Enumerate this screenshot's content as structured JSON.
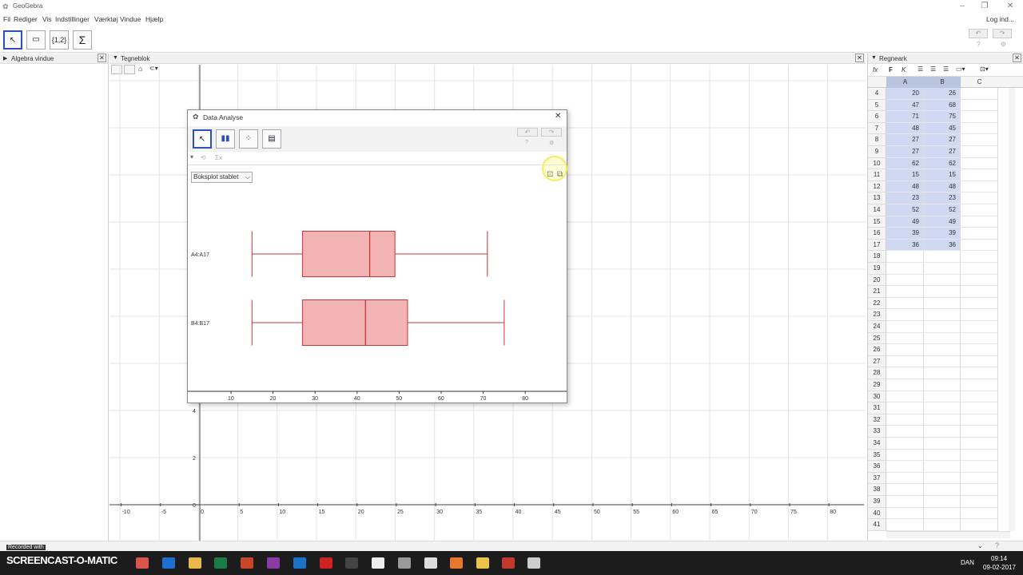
{
  "window": {
    "title": "GeoGebra",
    "login": "Log ind..."
  },
  "menu": [
    "Fil",
    "Rediger",
    "Vis",
    "Indstillinger",
    "Værktøj",
    "Vindue",
    "Hjælp"
  ],
  "toolbar": {
    "tools": [
      "↖",
      "▭",
      "{1,2}",
      "Σ"
    ]
  },
  "panels": {
    "algebra": "Algebra vindue",
    "graphics": "Tegneblok",
    "spreadsheet": "Regneark"
  },
  "graphics_axes": {
    "x_ticks": [
      "-10",
      "-5",
      "0",
      "5",
      "10",
      "15",
      "20",
      "25",
      "30",
      "35",
      "40",
      "45",
      "50",
      "55",
      "60",
      "65",
      "70",
      "75",
      "80"
    ],
    "y_ticks": [
      "0",
      "2",
      "4"
    ]
  },
  "sheet": {
    "columns": [
      "A",
      "B",
      "C"
    ],
    "rows": [
      {
        "n": "4",
        "a": "20",
        "b": "26"
      },
      {
        "n": "5",
        "a": "47",
        "b": "68"
      },
      {
        "n": "6",
        "a": "71",
        "b": "75"
      },
      {
        "n": "7",
        "a": "48",
        "b": "45"
      },
      {
        "n": "8",
        "a": "27",
        "b": "27"
      },
      {
        "n": "9",
        "a": "27",
        "b": "27"
      },
      {
        "n": "10",
        "a": "62",
        "b": "62"
      },
      {
        "n": "11",
        "a": "15",
        "b": "15"
      },
      {
        "n": "12",
        "a": "48",
        "b": "48"
      },
      {
        "n": "13",
        "a": "23",
        "b": "23"
      },
      {
        "n": "14",
        "a": "52",
        "b": "52"
      },
      {
        "n": "15",
        "a": "49",
        "b": "49"
      },
      {
        "n": "16",
        "a": "39",
        "b": "39"
      },
      {
        "n": "17",
        "a": "36",
        "b": "36"
      },
      {
        "n": "18",
        "a": "",
        "b": ""
      },
      {
        "n": "19",
        "a": "",
        "b": ""
      },
      {
        "n": "20",
        "a": "",
        "b": ""
      },
      {
        "n": "21",
        "a": "",
        "b": ""
      },
      {
        "n": "22",
        "a": "",
        "b": ""
      },
      {
        "n": "23",
        "a": "",
        "b": ""
      },
      {
        "n": "24",
        "a": "",
        "b": ""
      },
      {
        "n": "25",
        "a": "",
        "b": ""
      },
      {
        "n": "26",
        "a": "",
        "b": ""
      },
      {
        "n": "27",
        "a": "",
        "b": ""
      },
      {
        "n": "28",
        "a": "",
        "b": ""
      },
      {
        "n": "29",
        "a": "",
        "b": ""
      },
      {
        "n": "30",
        "a": "",
        "b": ""
      },
      {
        "n": "31",
        "a": "",
        "b": ""
      },
      {
        "n": "32",
        "a": "",
        "b": ""
      },
      {
        "n": "33",
        "a": "",
        "b": ""
      },
      {
        "n": "34",
        "a": "",
        "b": ""
      },
      {
        "n": "35",
        "a": "",
        "b": ""
      },
      {
        "n": "36",
        "a": "",
        "b": ""
      },
      {
        "n": "37",
        "a": "",
        "b": ""
      },
      {
        "n": "38",
        "a": "",
        "b": ""
      },
      {
        "n": "39",
        "a": "",
        "b": ""
      },
      {
        "n": "40",
        "a": "",
        "b": ""
      },
      {
        "n": "41",
        "a": "",
        "b": ""
      }
    ]
  },
  "dialog": {
    "title": "Data Analyse",
    "plot_select": "Boksplot stablet",
    "sigma": "Σx"
  },
  "chart_data": {
    "type": "boxplot",
    "x_ticks": [
      10,
      20,
      30,
      40,
      50,
      60,
      70,
      80
    ],
    "xlim": [
      2,
      88
    ],
    "series": [
      {
        "name": "A4:A17",
        "min": 15,
        "q1": 27,
        "median": 43,
        "q3": 49,
        "max": 71
      },
      {
        "name": "B4:B17",
        "min": 15,
        "q1": 27,
        "median": 42,
        "q3": 52,
        "max": 75
      }
    ],
    "box_color": "#f2b3b5",
    "line_color": "#cc3333"
  },
  "statusbar": {
    "left": "Recorded with",
    "brand": "SCREENCAST-O-MATIC"
  },
  "taskbar": {
    "time": "09:14",
    "date": "09-02-2017",
    "lang": "DAN"
  }
}
